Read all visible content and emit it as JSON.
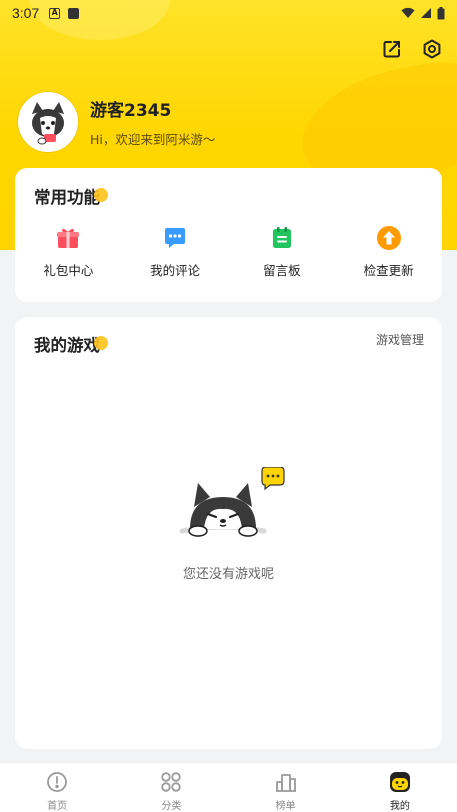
{
  "status_bar": {
    "time": "3:07"
  },
  "header": {
    "share_icon": "share-icon",
    "settings_icon": "gear-icon"
  },
  "profile": {
    "username": "游客2345",
    "welcome": "Hi，欢迎来到阿米游～"
  },
  "features_card": {
    "title": "常用功能",
    "items": [
      {
        "label": "礼包中心",
        "icon": "gift-icon",
        "color": "#ff4f5e"
      },
      {
        "label": "我的评论",
        "icon": "comment-icon",
        "color": "#3a9bff"
      },
      {
        "label": "留言板",
        "icon": "notepad-icon",
        "color": "#22c55e"
      },
      {
        "label": "检查更新",
        "icon": "upload-arrow-icon",
        "color": "#ff9a00"
      }
    ]
  },
  "games_card": {
    "title": "我的游戏",
    "manage_label": "游戏管理",
    "empty_text": "您还没有游戏呢"
  },
  "tabbar": {
    "items": [
      {
        "label": "首页",
        "icon": "home-icon",
        "active": false
      },
      {
        "label": "分类",
        "icon": "category-icon",
        "active": false
      },
      {
        "label": "榜单",
        "icon": "ranking-icon",
        "active": false
      },
      {
        "label": "我的",
        "icon": "profile-face-icon",
        "active": true
      }
    ]
  },
  "colors": {
    "accent": "#ffd400",
    "background": "#f2f3f5"
  }
}
